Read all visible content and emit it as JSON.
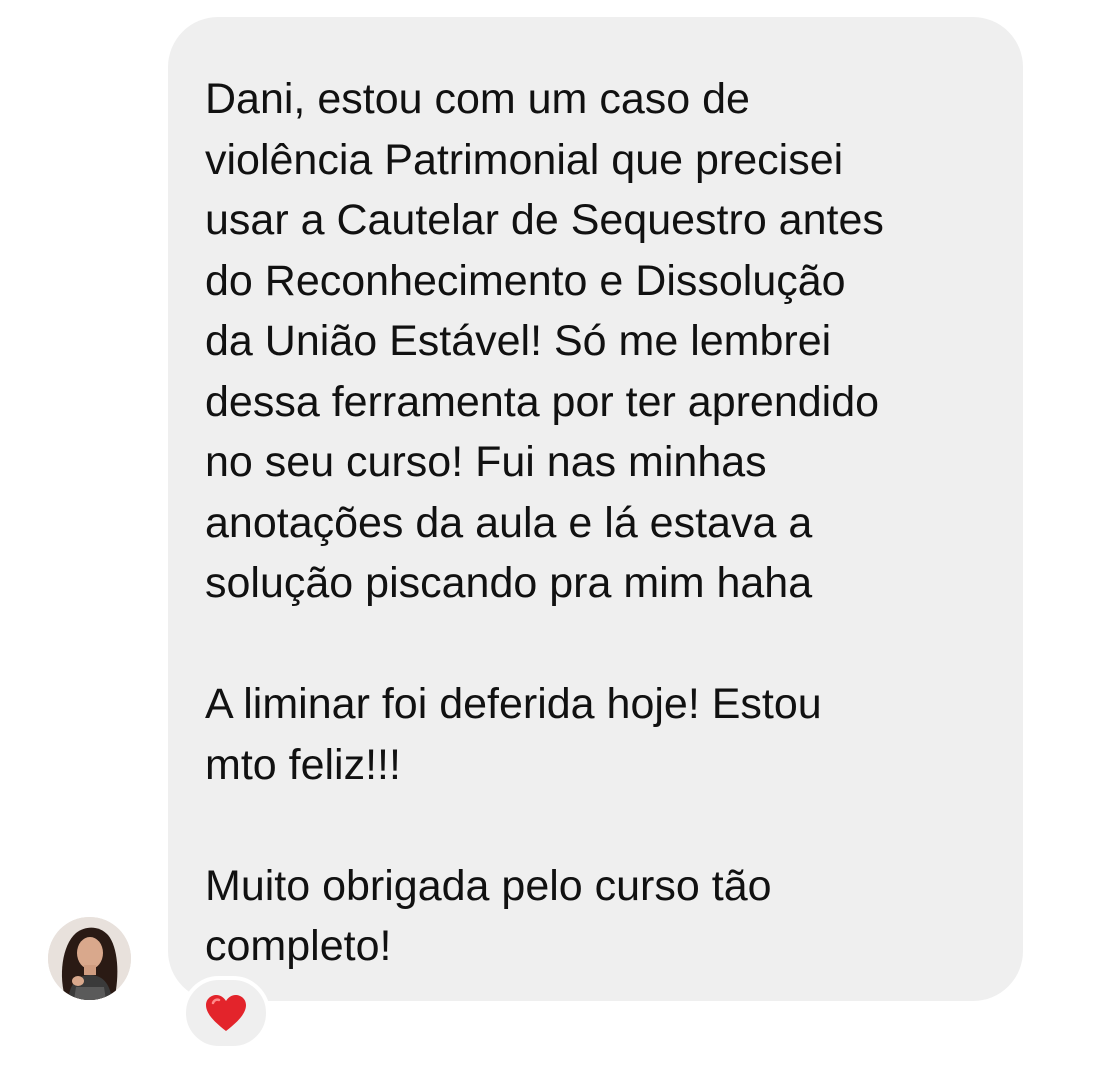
{
  "message": {
    "text": "Dani, estou com um caso de\nviolência Patrimonial que precisei\nusar a Cautelar de Sequestro antes\ndo Reconhecimento e Dissolução\nda União Estável!  Só me lembrei\ndessa ferramenta por ter aprendido\nno seu curso! Fui nas minhas\nanotações da aula e lá estava a\nsolução piscando pra mim haha\n\nA liminar foi deferida hoje! Estou\nmto feliz!!!\n\nMuito obrigada pelo curso tão\ncompleto!"
  },
  "sender": {
    "avatar_icon": "profile-photo"
  },
  "reaction": {
    "icon": "red-heart-icon",
    "color": "#e3242b"
  },
  "colors": {
    "bubble": "#efefef",
    "text": "#111111",
    "background": "#ffffff"
  }
}
